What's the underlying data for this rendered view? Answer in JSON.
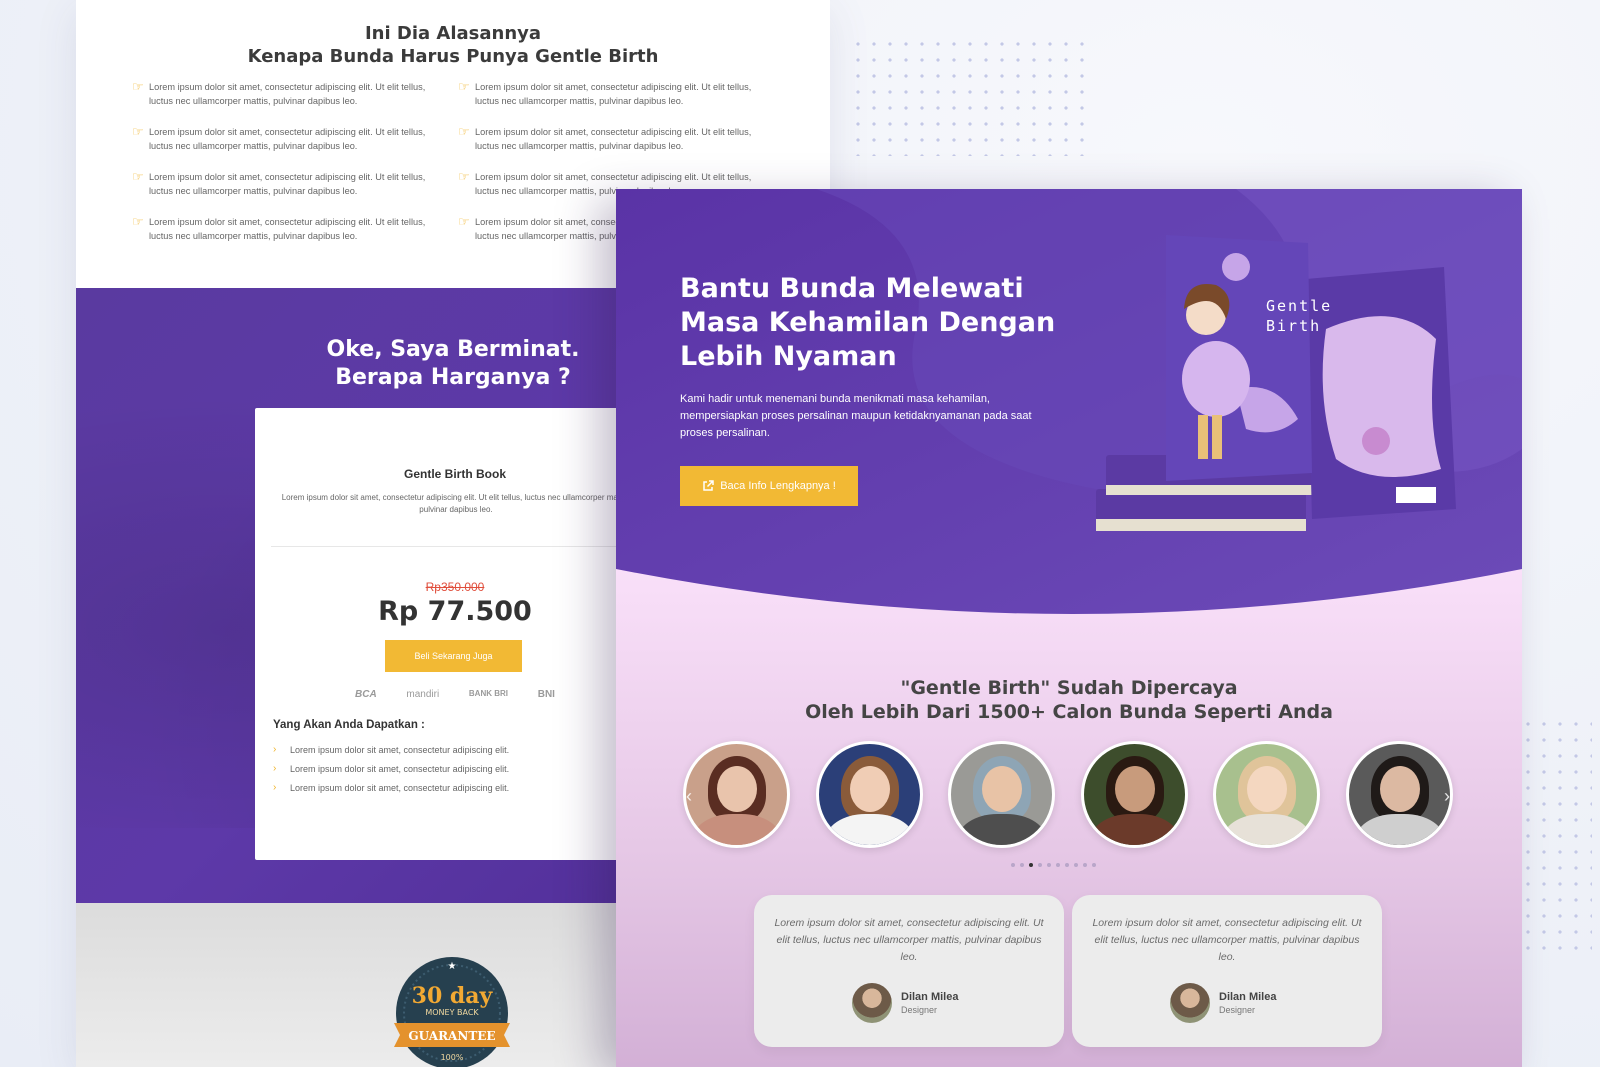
{
  "left_page": {
    "reasons_title": [
      "Ini Dia Alasannya",
      "Kenapa Bunda Harus Punya Gentle Birth"
    ],
    "reasons": [
      "Lorem ipsum dolor sit amet, consectetur adipiscing elit. Ut elit tellus, luctus nec ullamcorper mattis, pulvinar dapibus leo.",
      "Lorem ipsum dolor sit amet, consectetur adipiscing elit. Ut elit tellus, luctus nec ullamcorper mattis, pulvinar dapibus leo.",
      "Lorem ipsum dolor sit amet, consectetur adipiscing elit. Ut elit tellus, luctus nec ullamcorper mattis, pulvinar dapibus leo.",
      "Lorem ipsum dolor sit amet, consectetur adipiscing elit. Ut elit tellus, luctus nec ullamcorper mattis, pulvinar dapibus leo.",
      "Lorem ipsum dolor sit amet, consectetur adipiscing elit. Ut elit tellus, luctus nec ullamcorper mattis, pulvinar dapibus leo.",
      "Lorem ipsum dolor sit amet, consectetur adipiscing elit. Ut elit tellus, luctus nec ullamcorper mattis, pulvinar dapibus leo.",
      "Lorem ipsum dolor sit amet, consectetur adipiscing elit. Ut elit tellus, luctus nec ullamcorper mattis, pulvinar dapibus leo.",
      "Lorem ipsum dolor sit amet, consectetur adipiscing elit. Ut elit tellus, luctus nec ullamcorper mattis, pulvinar dapibus leo."
    ],
    "price_heading": [
      "Oke, Saya Berminat.",
      "Berapa Harganya ?"
    ],
    "card": {
      "title": "Gentle Birth Book",
      "description": "Lorem ipsum dolor sit amet, consectetur adipiscing elit. Ut elit tellus, luctus nec ullamcorper mattis, pulvinar dapibus leo.",
      "old_price": "Rp350.000",
      "new_price": "Rp 77.500",
      "buy_label": "Beli Sekarang Juga",
      "banks": [
        "BCA",
        "mandiri",
        "BANK BRI",
        "BNI"
      ],
      "benefits_title": "Yang Akan Anda Dapatkan :",
      "benefits": [
        "Lorem ipsum dolor sit amet, consectetur adipiscing elit.",
        "Lorem ipsum dolor sit amet, consectetur adipiscing elit.",
        "Lorem ipsum dolor sit amet, consectetur adipiscing elit."
      ]
    },
    "guarantee_badge": {
      "line1": "30 day",
      "line2": "MONEY BACK",
      "line3": "GUARANTEE",
      "line4": "100%"
    }
  },
  "right_page": {
    "hero": {
      "title_lines": [
        "Bantu Bunda Melewati",
        "Masa Kehamilan Dengan",
        "Lebih Nyaman"
      ],
      "description": "Kami hadir untuk menemani bunda menikmati masa kehamilan, mempersiapkan proses persalinan maupun ketidaknyamanan pada saat proses persalinan.",
      "cta_label": "Baca Info Lengkapnya !",
      "book_title": [
        "Gentle",
        "Birth"
      ]
    },
    "trust_title": [
      "\"Gentle Birth\" Sudah Dipercaya",
      "Oleh Lebih Dari 1500+ Calon Bunda Seperti Anda"
    ],
    "carousel": {
      "avatar_count": 6,
      "dots_total": 10,
      "active_dot_index": 2
    },
    "testimonials": [
      {
        "quote": "Lorem ipsum dolor sit amet, consectetur adipiscing elit. Ut elit tellus, luctus nec ullamcorper mattis, pulvinar dapibus leo.",
        "name": "Dilan Milea",
        "role": "Designer"
      },
      {
        "quote": "Lorem ipsum dolor sit amet, consectetur adipiscing elit. Ut elit tellus, luctus nec ullamcorper mattis, pulvinar dapibus leo.",
        "name": "Dilan Milea",
        "role": "Designer"
      }
    ]
  },
  "colors": {
    "purple": "#5d39a8",
    "accent_yellow": "#f2b934",
    "strike_red": "#e04e3c",
    "pink_bg": "#fde0ff"
  },
  "icons": [
    "hand-point-icon",
    "external-link-icon",
    "chevron-right-icon",
    "arrow-left-icon",
    "arrow-right-icon",
    "star-icon"
  ]
}
